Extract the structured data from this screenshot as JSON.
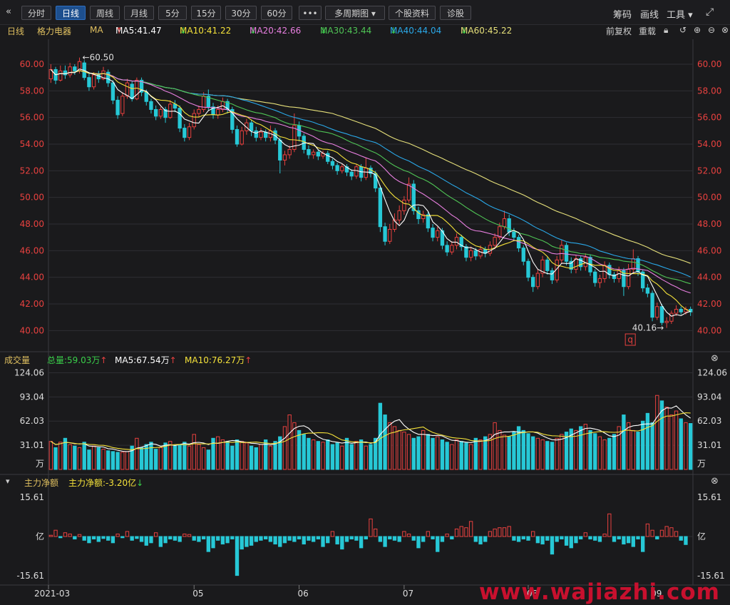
{
  "toolbar": {
    "collapse_icon": "double-chevron-left-icon",
    "buttons": [
      "分时",
      "日线",
      "周线",
      "月线",
      "5分",
      "15分",
      "30分",
      "60分"
    ],
    "active": "日线",
    "more": "•••",
    "multi_period": "多周期图",
    "stock_info": "个股资料",
    "diagnose": "诊股",
    "right": [
      "筹码",
      "画线",
      "工具"
    ],
    "fullscreen_icon": "fullscreen-icon"
  },
  "infobar": {
    "period": "日线",
    "stock_name": "格力电器",
    "ma_label": "MA",
    "ma5": "MA5:41.47",
    "ma10": "MA10:41.22",
    "ma20": "MA20:42.66",
    "ma30": "MA30:43.44",
    "ma40": "MA40:44.04",
    "ma60": "MA60:45.22",
    "adjust": "前复权",
    "reset": "重载"
  },
  "colors": {
    "up": "#e8413f",
    "down": "#27c8d6",
    "ma5": "#ffffff",
    "ma10": "#f5e23a",
    "ma20": "#e87fe0",
    "ma30": "#4fc455",
    "ma40": "#2aa8e8",
    "ma60": "#e6e07a"
  },
  "chart_data": [
    {
      "type": "candlestick",
      "name": "price",
      "ylim": [
        39.0,
        61.5
      ],
      "y_ticks": [
        "60.00",
        "58.00",
        "56.00",
        "54.00",
        "52.00",
        "50.00",
        "48.00",
        "46.00",
        "44.00",
        "42.00",
        "40.00"
      ],
      "annotations": {
        "high": "←60.50",
        "low": "40.16→",
        "marker": "q"
      },
      "candles": [
        {
          "o": 58.9,
          "c": 59.6,
          "h": 60.0,
          "l": 58.6
        },
        {
          "o": 59.6,
          "c": 58.8,
          "h": 59.8,
          "l": 58.5
        },
        {
          "o": 58.8,
          "c": 59.5,
          "h": 59.9,
          "l": 58.7
        },
        {
          "o": 59.5,
          "c": 59.2,
          "h": 59.9,
          "l": 58.9
        },
        {
          "o": 59.2,
          "c": 59.8,
          "h": 60.1,
          "l": 59.0
        },
        {
          "o": 59.8,
          "c": 59.5,
          "h": 60.0,
          "l": 59.2
        },
        {
          "o": 59.5,
          "c": 60.2,
          "h": 60.5,
          "l": 59.3
        },
        {
          "o": 60.1,
          "c": 59.0,
          "h": 60.3,
          "l": 58.8
        },
        {
          "o": 59.0,
          "c": 58.3,
          "h": 59.3,
          "l": 58.0
        },
        {
          "o": 58.3,
          "c": 59.2,
          "h": 59.4,
          "l": 58.1
        },
        {
          "o": 59.2,
          "c": 58.9,
          "h": 59.5,
          "l": 58.6
        },
        {
          "o": 58.9,
          "c": 59.5,
          "h": 59.8,
          "l": 58.8
        },
        {
          "o": 59.4,
          "c": 58.6,
          "h": 59.6,
          "l": 58.3
        },
        {
          "o": 58.6,
          "c": 57.3,
          "h": 58.8,
          "l": 57.0
        },
        {
          "o": 57.3,
          "c": 56.2,
          "h": 57.6,
          "l": 55.9
        },
        {
          "o": 56.3,
          "c": 57.6,
          "h": 57.9,
          "l": 56.1
        },
        {
          "o": 57.6,
          "c": 58.6,
          "h": 58.9,
          "l": 57.4
        },
        {
          "o": 58.5,
          "c": 57.4,
          "h": 58.7,
          "l": 57.2
        },
        {
          "o": 57.4,
          "c": 58.8,
          "h": 59.0,
          "l": 57.3
        },
        {
          "o": 58.8,
          "c": 57.9,
          "h": 59.0,
          "l": 57.6
        },
        {
          "o": 57.9,
          "c": 57.2,
          "h": 58.1,
          "l": 56.9
        },
        {
          "o": 57.2,
          "c": 56.6,
          "h": 57.4,
          "l": 56.3
        },
        {
          "o": 56.6,
          "c": 56.1,
          "h": 56.9,
          "l": 55.8
        },
        {
          "o": 56.1,
          "c": 56.6,
          "h": 56.8,
          "l": 55.9
        },
        {
          "o": 56.6,
          "c": 56.0,
          "h": 56.8,
          "l": 55.6
        },
        {
          "o": 56.0,
          "c": 57.0,
          "h": 57.3,
          "l": 55.9
        },
        {
          "o": 57.0,
          "c": 56.7,
          "h": 57.3,
          "l": 56.4
        },
        {
          "o": 56.7,
          "c": 55.2,
          "h": 56.9,
          "l": 54.9
        },
        {
          "o": 55.2,
          "c": 54.5,
          "h": 55.5,
          "l": 54.2
        },
        {
          "o": 54.5,
          "c": 55.3,
          "h": 55.6,
          "l": 54.3
        },
        {
          "o": 55.3,
          "c": 56.3,
          "h": 56.6,
          "l": 55.1
        },
        {
          "o": 56.3,
          "c": 56.6,
          "h": 56.9,
          "l": 56.0
        },
        {
          "o": 56.6,
          "c": 57.6,
          "h": 57.9,
          "l": 56.4
        },
        {
          "o": 57.6,
          "c": 56.8,
          "h": 58.1,
          "l": 56.5
        },
        {
          "o": 56.8,
          "c": 56.2,
          "h": 57.1,
          "l": 55.9
        },
        {
          "o": 56.2,
          "c": 56.6,
          "h": 56.9,
          "l": 55.9
        },
        {
          "o": 56.6,
          "c": 57.2,
          "h": 57.5,
          "l": 56.4
        },
        {
          "o": 57.2,
          "c": 56.6,
          "h": 57.4,
          "l": 56.3
        },
        {
          "o": 56.6,
          "c": 55.1,
          "h": 56.8,
          "l": 54.8
        },
        {
          "o": 55.1,
          "c": 54.0,
          "h": 55.4,
          "l": 53.8
        },
        {
          "o": 54.0,
          "c": 55.0,
          "h": 55.3,
          "l": 53.9
        },
        {
          "o": 55.0,
          "c": 55.6,
          "h": 55.9,
          "l": 54.7
        },
        {
          "o": 55.6,
          "c": 55.0,
          "h": 55.8,
          "l": 54.6
        },
        {
          "o": 55.0,
          "c": 54.5,
          "h": 55.3,
          "l": 54.2
        },
        {
          "o": 54.5,
          "c": 54.9,
          "h": 55.2,
          "l": 54.3
        },
        {
          "o": 54.9,
          "c": 54.5,
          "h": 55.1,
          "l": 54.2
        },
        {
          "o": 54.5,
          "c": 55.0,
          "h": 55.4,
          "l": 54.2
        },
        {
          "o": 55.0,
          "c": 54.3,
          "h": 55.2,
          "l": 54.0
        },
        {
          "o": 54.3,
          "c": 52.8,
          "h": 54.5,
          "l": 51.8
        },
        {
          "o": 52.8,
          "c": 53.2,
          "h": 53.5,
          "l": 52.4
        },
        {
          "o": 53.2,
          "c": 53.6,
          "h": 53.9,
          "l": 52.9
        },
        {
          "o": 53.6,
          "c": 55.4,
          "h": 56.3,
          "l": 53.4
        },
        {
          "o": 55.4,
          "c": 54.6,
          "h": 55.7,
          "l": 54.2
        },
        {
          "o": 54.6,
          "c": 53.6,
          "h": 54.8,
          "l": 53.3
        },
        {
          "o": 53.6,
          "c": 53.2,
          "h": 53.9,
          "l": 52.9
        },
        {
          "o": 53.2,
          "c": 53.4,
          "h": 53.6,
          "l": 52.9
        },
        {
          "o": 53.4,
          "c": 53.1,
          "h": 53.6,
          "l": 52.8
        },
        {
          "o": 53.1,
          "c": 53.3,
          "h": 53.5,
          "l": 52.9
        },
        {
          "o": 53.3,
          "c": 52.7,
          "h": 53.5,
          "l": 52.5
        },
        {
          "o": 52.7,
          "c": 52.4,
          "h": 52.9,
          "l": 52.1
        },
        {
          "o": 52.4,
          "c": 52.0,
          "h": 52.6,
          "l": 51.7
        },
        {
          "o": 52.0,
          "c": 52.3,
          "h": 52.5,
          "l": 51.8
        },
        {
          "o": 52.3,
          "c": 51.9,
          "h": 52.5,
          "l": 51.6
        },
        {
          "o": 51.9,
          "c": 51.6,
          "h": 52.1,
          "l": 51.3
        },
        {
          "o": 51.6,
          "c": 52.3,
          "h": 52.5,
          "l": 51.4
        },
        {
          "o": 52.3,
          "c": 51.5,
          "h": 52.5,
          "l": 51.2
        },
        {
          "o": 51.5,
          "c": 52.2,
          "h": 53.0,
          "l": 51.3
        },
        {
          "o": 52.2,
          "c": 51.8,
          "h": 52.4,
          "l": 51.5
        },
        {
          "o": 51.8,
          "c": 50.7,
          "h": 52.0,
          "l": 50.4
        },
        {
          "o": 50.7,
          "c": 47.8,
          "h": 50.9,
          "l": 47.4
        },
        {
          "o": 47.8,
          "c": 46.7,
          "h": 48.1,
          "l": 46.4
        },
        {
          "o": 46.7,
          "c": 47.6,
          "h": 48.0,
          "l": 46.5
        },
        {
          "o": 47.6,
          "c": 48.3,
          "h": 48.8,
          "l": 47.4
        },
        {
          "o": 48.3,
          "c": 49.0,
          "h": 49.4,
          "l": 48.0
        },
        {
          "o": 49.0,
          "c": 49.8,
          "h": 50.1,
          "l": 48.7
        },
        {
          "o": 49.8,
          "c": 51.0,
          "h": 51.5,
          "l": 49.6
        },
        {
          "o": 51.0,
          "c": 49.0,
          "h": 51.3,
          "l": 48.7
        },
        {
          "o": 49.0,
          "c": 48.4,
          "h": 49.3,
          "l": 48.0
        },
        {
          "o": 48.4,
          "c": 48.7,
          "h": 49.0,
          "l": 48.1
        },
        {
          "o": 48.7,
          "c": 47.7,
          "h": 48.9,
          "l": 47.4
        },
        {
          "o": 47.7,
          "c": 47.0,
          "h": 48.0,
          "l": 46.7
        },
        {
          "o": 47.0,
          "c": 47.5,
          "h": 47.8,
          "l": 46.7
        },
        {
          "o": 47.5,
          "c": 46.4,
          "h": 47.7,
          "l": 46.1
        },
        {
          "o": 46.4,
          "c": 45.9,
          "h": 46.7,
          "l": 45.6
        },
        {
          "o": 45.9,
          "c": 46.4,
          "h": 46.7,
          "l": 45.7
        },
        {
          "o": 46.4,
          "c": 47.0,
          "h": 47.3,
          "l": 46.1
        },
        {
          "o": 47.0,
          "c": 46.3,
          "h": 47.2,
          "l": 46.0
        },
        {
          "o": 46.3,
          "c": 45.5,
          "h": 46.5,
          "l": 45.2
        },
        {
          "o": 45.5,
          "c": 46.0,
          "h": 46.3,
          "l": 45.2
        },
        {
          "o": 46.0,
          "c": 45.6,
          "h": 46.2,
          "l": 45.3
        },
        {
          "o": 45.6,
          "c": 46.1,
          "h": 46.4,
          "l": 45.4
        },
        {
          "o": 46.1,
          "c": 45.8,
          "h": 46.3,
          "l": 45.5
        },
        {
          "o": 45.8,
          "c": 46.4,
          "h": 46.7,
          "l": 45.6
        },
        {
          "o": 46.4,
          "c": 47.0,
          "h": 47.3,
          "l": 46.1
        },
        {
          "o": 47.0,
          "c": 47.8,
          "h": 48.1,
          "l": 46.8
        },
        {
          "o": 47.8,
          "c": 48.4,
          "h": 49.0,
          "l": 47.6
        },
        {
          "o": 48.4,
          "c": 47.4,
          "h": 48.7,
          "l": 47.1
        },
        {
          "o": 47.4,
          "c": 47.0,
          "h": 47.7,
          "l": 46.7
        },
        {
          "o": 47.0,
          "c": 46.2,
          "h": 47.2,
          "l": 45.9
        },
        {
          "o": 46.2,
          "c": 45.2,
          "h": 46.4,
          "l": 44.9
        },
        {
          "o": 45.2,
          "c": 44.0,
          "h": 45.4,
          "l": 43.7
        },
        {
          "o": 44.0,
          "c": 43.3,
          "h": 44.2,
          "l": 42.9
        },
        {
          "o": 43.3,
          "c": 44.3,
          "h": 44.6,
          "l": 43.1
        },
        {
          "o": 44.3,
          "c": 45.3,
          "h": 45.6,
          "l": 44.0
        },
        {
          "o": 45.3,
          "c": 44.5,
          "h": 45.5,
          "l": 44.2
        },
        {
          "o": 44.5,
          "c": 43.8,
          "h": 44.7,
          "l": 43.5
        },
        {
          "o": 43.8,
          "c": 45.3,
          "h": 45.6,
          "l": 43.6
        },
        {
          "o": 45.3,
          "c": 46.4,
          "h": 46.8,
          "l": 45.0
        },
        {
          "o": 46.4,
          "c": 45.2,
          "h": 46.6,
          "l": 44.9
        },
        {
          "o": 45.2,
          "c": 44.6,
          "h": 45.5,
          "l": 44.3
        },
        {
          "o": 44.6,
          "c": 45.4,
          "h": 45.7,
          "l": 44.3
        },
        {
          "o": 45.4,
          "c": 44.8,
          "h": 45.6,
          "l": 44.5
        },
        {
          "o": 44.8,
          "c": 45.5,
          "h": 45.8,
          "l": 44.5
        },
        {
          "o": 45.5,
          "c": 44.4,
          "h": 45.7,
          "l": 44.1
        },
        {
          "o": 44.4,
          "c": 43.6,
          "h": 44.6,
          "l": 43.3
        },
        {
          "o": 43.6,
          "c": 43.9,
          "h": 44.2,
          "l": 43.2
        },
        {
          "o": 43.9,
          "c": 44.9,
          "h": 45.2,
          "l": 43.6
        },
        {
          "o": 44.9,
          "c": 44.2,
          "h": 45.1,
          "l": 43.9
        },
        {
          "o": 44.2,
          "c": 43.9,
          "h": 44.4,
          "l": 43.6
        },
        {
          "o": 43.9,
          "c": 44.5,
          "h": 44.8,
          "l": 43.6
        },
        {
          "o": 44.5,
          "c": 43.3,
          "h": 44.7,
          "l": 42.6
        },
        {
          "o": 43.3,
          "c": 44.6,
          "h": 45.0,
          "l": 43.1
        },
        {
          "o": 44.6,
          "c": 45.4,
          "h": 46.1,
          "l": 44.3
        },
        {
          "o": 45.4,
          "c": 44.4,
          "h": 45.6,
          "l": 44.1
        },
        {
          "o": 44.4,
          "c": 43.2,
          "h": 44.6,
          "l": 42.9
        },
        {
          "o": 43.2,
          "c": 42.8,
          "h": 43.5,
          "l": 42.5
        },
        {
          "o": 42.8,
          "c": 41.0,
          "h": 43.0,
          "l": 40.7
        },
        {
          "o": 41.0,
          "c": 41.8,
          "h": 42.1,
          "l": 40.8
        },
        {
          "o": 41.8,
          "c": 40.6,
          "h": 42.0,
          "l": 40.4
        },
        {
          "o": 40.6,
          "c": 40.7,
          "h": 41.0,
          "l": 40.2
        },
        {
          "o": 40.7,
          "c": 41.3,
          "h": 41.5,
          "l": 40.5
        },
        {
          "o": 41.3,
          "c": 41.6,
          "h": 41.9,
          "l": 41.1
        },
        {
          "o": 41.6,
          "c": 41.4,
          "h": 41.8,
          "l": 41.2
        },
        {
          "o": 41.4,
          "c": 41.6,
          "h": 41.8,
          "l": 41.2
        },
        {
          "o": 41.6,
          "c": 41.4,
          "h": 41.8,
          "l": 41.1
        }
      ]
    },
    {
      "type": "bar",
      "name": "volume",
      "title": "成交量",
      "total": "总量:59.03万",
      "ma5": "MA5:67.54万",
      "ma10": "MA10:76.27万",
      "ylim": [
        0,
        130
      ],
      "y_ticks": [
        "124.06",
        "93.04",
        "62.03",
        "31.01"
      ],
      "unit": "万",
      "values": [
        36,
        28,
        35,
        40,
        32,
        30,
        28,
        35,
        25,
        30,
        28,
        26,
        24,
        23,
        22,
        22,
        23,
        30,
        40,
        28,
        32,
        35,
        26,
        28,
        34,
        36,
        30,
        32,
        35,
        30,
        45,
        32,
        28,
        25,
        40,
        42,
        38,
        36,
        30,
        38,
        36,
        34,
        30,
        28,
        32,
        38,
        30,
        36,
        42,
        55,
        70,
        60,
        50,
        45,
        40,
        38,
        36,
        35,
        38,
        32,
        34,
        30,
        40,
        32,
        36,
        38,
        30,
        32,
        40,
        85,
        70,
        60,
        55,
        50,
        48,
        45,
        40,
        42,
        50,
        45,
        40,
        42,
        38,
        35,
        32,
        38,
        36,
        34,
        32,
        40,
        38,
        42,
        45,
        60,
        50,
        44,
        42,
        48,
        55,
        50,
        46,
        42,
        40,
        38,
        36,
        35,
        40,
        45,
        48,
        52,
        50,
        55,
        58,
        50,
        46,
        42,
        38,
        40,
        45,
        55,
        70,
        60,
        50,
        48,
        62,
        72,
        60,
        95,
        88,
        80,
        70,
        75,
        65,
        60,
        59
      ]
    },
    {
      "type": "bar",
      "name": "main_net",
      "title": "主力净额",
      "value": "主力净额:-3.20亿",
      "ylim": [
        -15.61,
        15.61
      ],
      "y_ticks": [
        "15.61",
        "亿",
        "-15.61"
      ],
      "values": [
        0.5,
        2.5,
        -0.5,
        1.5,
        1.0,
        -1.0,
        0.8,
        -1.5,
        -2.5,
        -1.0,
        -2.0,
        -0.8,
        -1.5,
        -2.5,
        1.0,
        -0.5,
        2.0,
        -1.5,
        -0.8,
        -2.0,
        -3.5,
        -2.5,
        1.5,
        -4.0,
        -2.5,
        -1.0,
        -1.5,
        -2.0,
        1.0,
        0.8,
        -1.5,
        -2.0,
        -1.0,
        -6.0,
        -4.5,
        -1.5,
        -3.0,
        -2.5,
        -1.0,
        -15.5,
        -5.0,
        -4.0,
        -3.5,
        -2.0,
        -1.5,
        -1.0,
        -2.0,
        -3.0,
        -4.0,
        -2.5,
        -1.5,
        -2.0,
        -1.0,
        -3.0,
        -1.5,
        -2.0,
        -1.0,
        -4.0,
        -2.5,
        2.0,
        -3.0,
        -5.0,
        -2.0,
        -1.0,
        -1.5,
        -4.5,
        -1.0,
        7.0,
        3.0,
        -2.0,
        -4.0,
        -1.0,
        -1.5,
        -2.0,
        2.0,
        1.0,
        -1.5,
        -4.5,
        -2.0,
        2.0,
        -1.0,
        -6.0,
        -2.0,
        1.0,
        -1.0,
        3.0,
        4.0,
        3.5,
        6.0,
        -2.0,
        -3.0,
        -2.0,
        2.0,
        3.0,
        3.5,
        3.5,
        4.0,
        -1.5,
        -2.0,
        -1.0,
        -1.5,
        2.0,
        -2.5,
        -3.0,
        -1.5,
        -7.0,
        -2.0,
        -1.0,
        -3.5,
        -4.5,
        -2.5,
        -1.0,
        1.5,
        -1.0,
        -1.5,
        -2.0,
        1.0,
        9.0,
        -2.0,
        -1.0,
        -3.0,
        -2.5,
        -4.0,
        -1.0,
        -6.0,
        5.0,
        2.5,
        -1.0,
        2.5,
        4.0,
        3.5,
        2.0,
        -1.5,
        -3.2
      ]
    }
  ],
  "x_axis": {
    "labels": [
      "2021-03",
      "05",
      "06",
      "07",
      "08",
      "09"
    ],
    "label_index": [
      0,
      30,
      52,
      74,
      100,
      126
    ]
  },
  "watermark": "www.wajiazhi.com"
}
